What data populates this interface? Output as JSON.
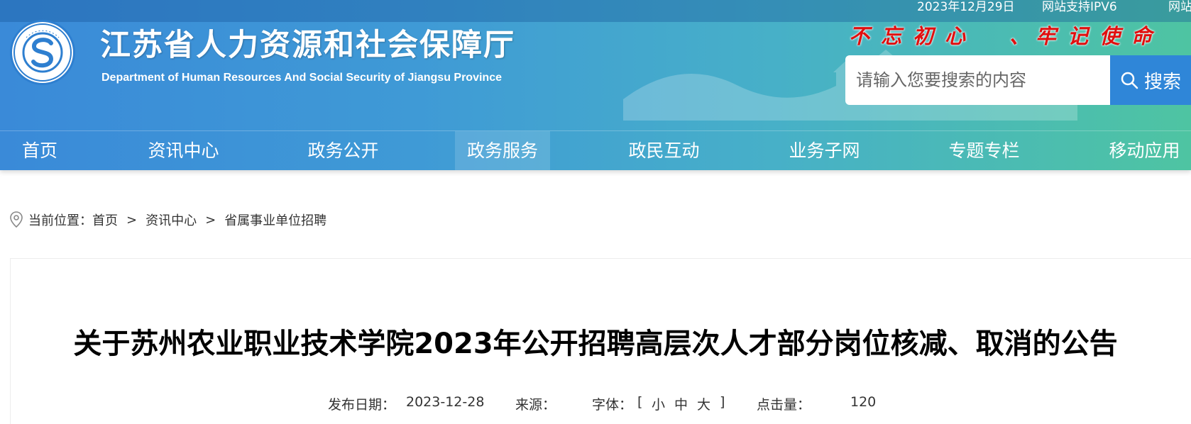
{
  "topbar": {
    "date": "2023年12月29日",
    "ipv6": "网站支持IPV6",
    "cut_link": "网站"
  },
  "site": {
    "title": "江苏省人力资源和社会保障厅",
    "subtitle": "Department of Human Resources And Social Security of Jiangsu Province",
    "logo_ring_text": "江苏省人力资源和社会保障厅",
    "slogan": [
      "不",
      "忘",
      "初",
      "心",
      "、",
      "牢",
      "记",
      "使",
      "命"
    ]
  },
  "search": {
    "placeholder": "请输入您要搜索的内容",
    "button_label": "搜索",
    "icon": "search-icon"
  },
  "nav": {
    "items": [
      {
        "label": "首页"
      },
      {
        "label": "资讯中心"
      },
      {
        "label": "政务公开"
      },
      {
        "label": "政务服务",
        "active": true
      },
      {
        "label": "政民互动"
      },
      {
        "label": "业务子网"
      },
      {
        "label": "专题专栏"
      },
      {
        "label": "移动应用"
      }
    ]
  },
  "breadcrumb": {
    "icon": "location-pin-icon",
    "prefix": "当前位置：",
    "items": [
      "首页",
      "资讯中心",
      "省属事业单位招聘"
    ],
    "separator": ">"
  },
  "article": {
    "title": "关于苏州农业职业技术学院2023年公开招聘高层次人才部分岗位核减、取消的公告",
    "meta": {
      "date_label": "发布日期：",
      "date": "2023-12-28",
      "source_label": "来源：",
      "source": "",
      "font_label": "字体：",
      "font_open": "[",
      "font_small": "小",
      "font_medium": "中",
      "font_large": "大",
      "font_close": "]",
      "views_label": "点击量：",
      "views": "120"
    }
  },
  "colors": {
    "header_start": "#3a8ad8",
    "header_end": "#4ec4a2",
    "slogan": "#e10f0f",
    "search_button": "#2f86d8"
  }
}
